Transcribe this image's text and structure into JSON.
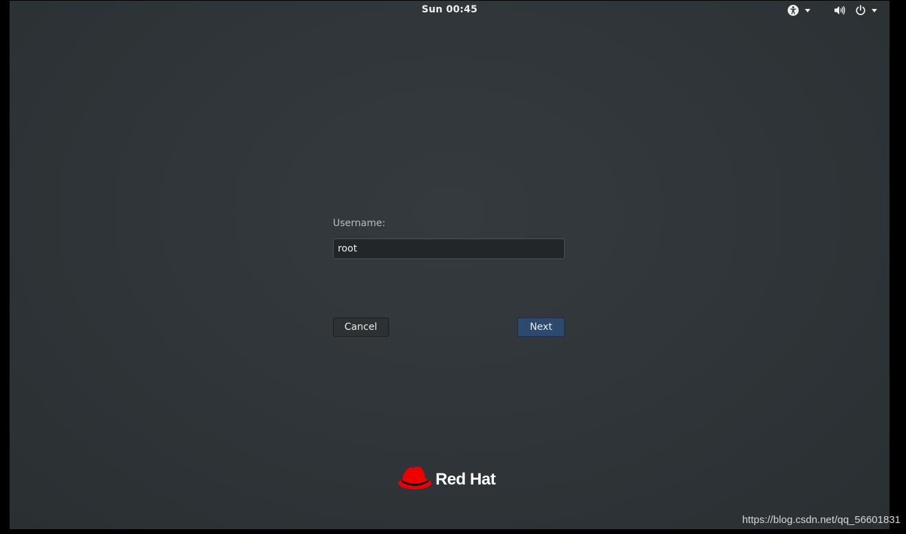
{
  "topbar": {
    "clock": "Sun 00:45",
    "icons": {
      "accessibility": "accessibility-icon",
      "volume": "volume-icon",
      "power": "power-icon"
    }
  },
  "login": {
    "username_label": "Username:",
    "username_value": "root",
    "cancel_label": "Cancel",
    "next_label": "Next"
  },
  "branding": {
    "logo_text": "Red Hat",
    "logo_color": "#ee0000"
  },
  "watermark": "https://blog.csdn.net/qq_56601831",
  "colors": {
    "next_button": "#2c4a6e",
    "background": "#2e3437"
  }
}
